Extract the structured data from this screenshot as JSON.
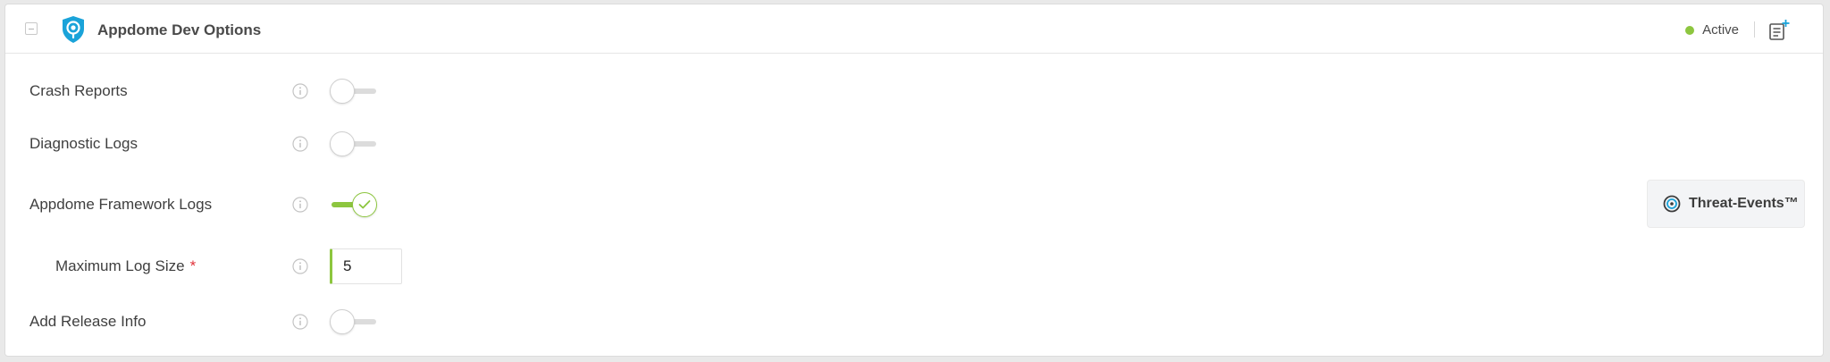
{
  "header": {
    "title": "Appdome Dev Options",
    "status_label": "Active",
    "status_color": "#8dc63f"
  },
  "icons": {
    "collapse": "collapse-minus-icon",
    "logo": "shield-pin-icon",
    "add_note": "add-note-icon",
    "info": "info-icon",
    "threat": "target-icon",
    "check": "check-icon"
  },
  "options": [
    {
      "label": "Crash Reports",
      "enabled": false
    },
    {
      "label": "Diagnostic Logs",
      "enabled": false
    },
    {
      "label": "Appdome Framework Logs",
      "enabled": true
    },
    {
      "label": "Maximum Log Size",
      "required_mark": "*",
      "value": "5"
    },
    {
      "label": "Add Release Info",
      "enabled": false
    }
  ],
  "threat_events": {
    "label": "Threat-Events™"
  },
  "colors": {
    "accent_green": "#8dc63f",
    "brand_blue": "#1aa3d9",
    "required_red": "#e0323a"
  }
}
